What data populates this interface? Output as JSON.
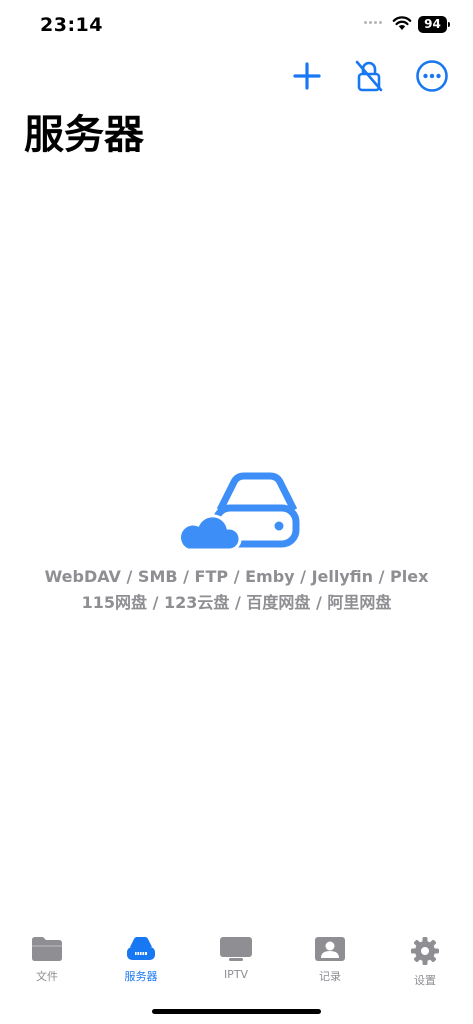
{
  "status_bar": {
    "time": "23:14",
    "battery": "94"
  },
  "header": {
    "title": "服务器"
  },
  "toolbar": {
    "add_icon": "plus-icon",
    "lock_icon": "lock-slash-icon",
    "more_icon": "ellipsis-circle-icon"
  },
  "empty_state": {
    "illustration": "server-cloud-icon",
    "protocols": "WebDAV / SMB / FTP / Emby / Jellyfin / Plex",
    "clouds": "115网盘 / 123云盘 / 百度网盘 / 阿里网盘"
  },
  "tabs": [
    {
      "label": "文件",
      "icon": "folder-icon",
      "active": false
    },
    {
      "label": "服务器",
      "icon": "server-icon",
      "active": true
    },
    {
      "label": "IPTV",
      "icon": "tv-icon",
      "active": false
    },
    {
      "label": "记录",
      "icon": "person-card-icon",
      "active": false
    },
    {
      "label": "设置",
      "icon": "gear-icon",
      "active": false
    }
  ],
  "colors": {
    "accent": "#1877f2",
    "illustration": "#3e8ef7",
    "inactive": "#8e8e93"
  }
}
